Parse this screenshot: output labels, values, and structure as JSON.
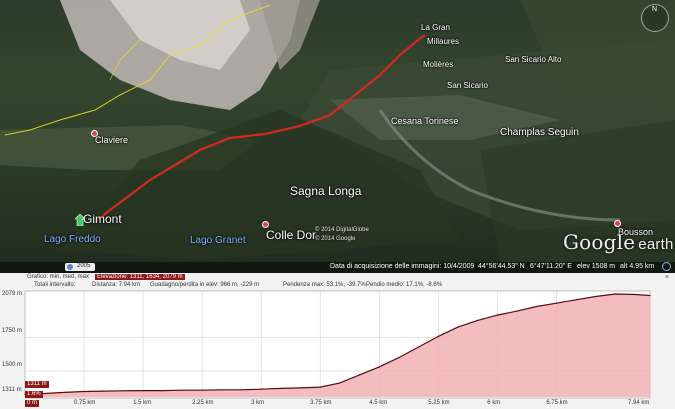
{
  "map": {
    "places": {
      "la_gran": "La Gran",
      "millaures": "Millaures",
      "molieres": "Molières",
      "san_sicario_alto": "San Sicario Alto",
      "san_sicario": "San Sicario",
      "cesana_torinese": "Cesana Torinese",
      "champlas_seguin": "Champlas Seguin",
      "claviere": "Claviere",
      "sagna_longa": "Sagna Longa",
      "gimont": "Gimont",
      "colle_bercia": "Colle Dor",
      "lago_freddo": "Lago Freddo",
      "lago_granet": "Lago Granet",
      "bousson": "Bousson"
    },
    "copyright_1": "© 2014 DigitalGlobe",
    "copyright_2": "© 2014 Google",
    "logo_google": "Google",
    "logo_earth": "earth",
    "compass_letter": "N",
    "status": {
      "year": "2005",
      "acquisition_date": "Data di acquisizione delle immagini: 10/4/2009",
      "lat": "44°56'44.53\" N",
      "lon": "6°47'11.20\" E",
      "elev": "elev 1508 m",
      "alt": "alt 4.95 km"
    },
    "colors": {
      "route": "#d42a1e",
      "border": "#e8e020"
    }
  },
  "profile": {
    "row1": {
      "graph_label": "Grafico: min, med, max",
      "elevation_label": "Elevazione: 1311, 1634, 2079 m",
      "close": "×"
    },
    "row2": {
      "totals": "Totali intervallo:",
      "distance": "Distanza: 7.94 km",
      "gain_loss": "Guadagno/perdita in elev: 966 m, -229 m",
      "slope": "Pendenza max: 53.1%, -39.7%",
      "avg_slope": "Pendio medio: 17.1%, -8.6%"
    },
    "y_ticks": [
      "2079 m",
      "1750 m",
      "1500 m",
      "1311 m"
    ],
    "x_ticks": [
      "0 m",
      "0.75 km",
      "1.5 km",
      "2.25 km",
      "3 km",
      "3.75 km",
      "4.5 km",
      "5.25 km",
      "6 km",
      "6.75 km",
      "7.94 km"
    ],
    "markers": {
      "elev": "1311 m",
      "slope": "1.6%",
      "pos": "0 m"
    }
  },
  "chart_data": {
    "type": "area",
    "xlabel": "",
    "ylabel": "",
    "xlim": [
      0,
      7.94
    ],
    "ylim": [
      1311,
      2079
    ],
    "x": [
      0,
      0.25,
      0.5,
      0.75,
      1.0,
      1.25,
      1.5,
      1.75,
      2.0,
      2.25,
      2.5,
      2.75,
      3.0,
      3.25,
      3.5,
      3.75,
      4.0,
      4.25,
      4.5,
      4.75,
      5.0,
      5.25,
      5.5,
      5.75,
      6.0,
      6.25,
      6.5,
      6.75,
      7.0,
      7.25,
      7.5,
      7.75,
      7.94
    ],
    "y": [
      1325,
      1330,
      1338,
      1345,
      1348,
      1350,
      1352,
      1352,
      1355,
      1355,
      1358,
      1358,
      1362,
      1368,
      1372,
      1378,
      1410,
      1470,
      1530,
      1600,
      1680,
      1760,
      1830,
      1880,
      1920,
      1950,
      1985,
      2010,
      2035,
      2060,
      2079,
      2075,
      2068
    ],
    "series": [
      {
        "values_ref": "y"
      }
    ]
  }
}
